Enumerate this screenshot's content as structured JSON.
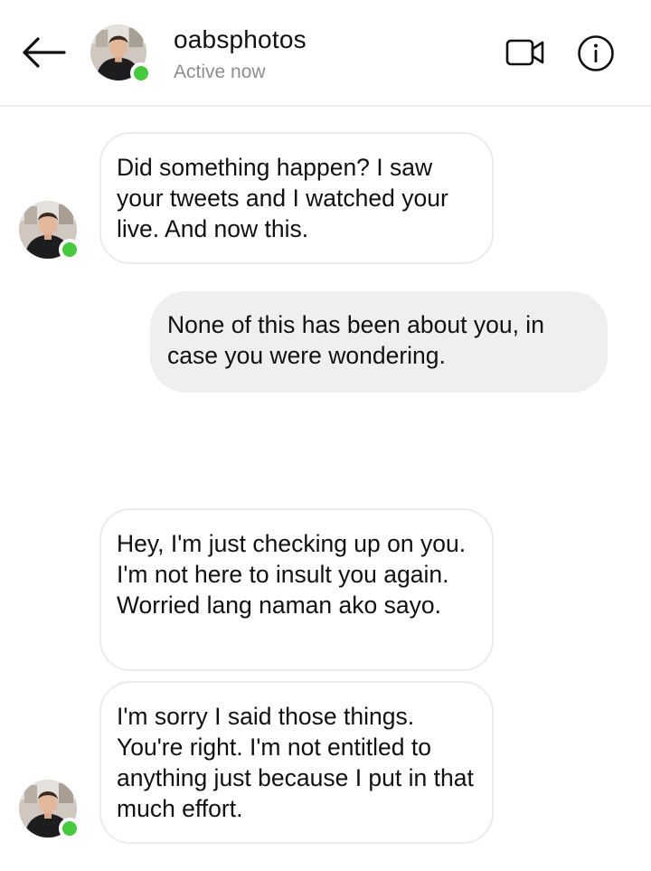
{
  "header": {
    "username": "oabsphotos",
    "status": "Active now"
  },
  "icons": {
    "back": "arrow-left-icon",
    "video": "video-camera-icon",
    "info": "info-circle-icon"
  },
  "colors": {
    "online_dot": "#47c93f",
    "outgoing_bubble": "#efefef",
    "incoming_border": "#ebebeb",
    "status_text": "#8e8e8e"
  },
  "messages": [
    {
      "sender": "them",
      "text": "Did something happen? I saw your tweets and I watched your live. And now this."
    },
    {
      "sender": "me",
      "text": "None of this has been about you, in case you were wondering."
    },
    {
      "sender": "them",
      "text": "Hey, I'm just checking up on you. I'm not here to insult you again. Worried lang naman ako sayo."
    },
    {
      "sender": "them",
      "text": "I'm sorry I said those things. You're right. I'm not entitled to anything just because I put in that much effort."
    }
  ]
}
